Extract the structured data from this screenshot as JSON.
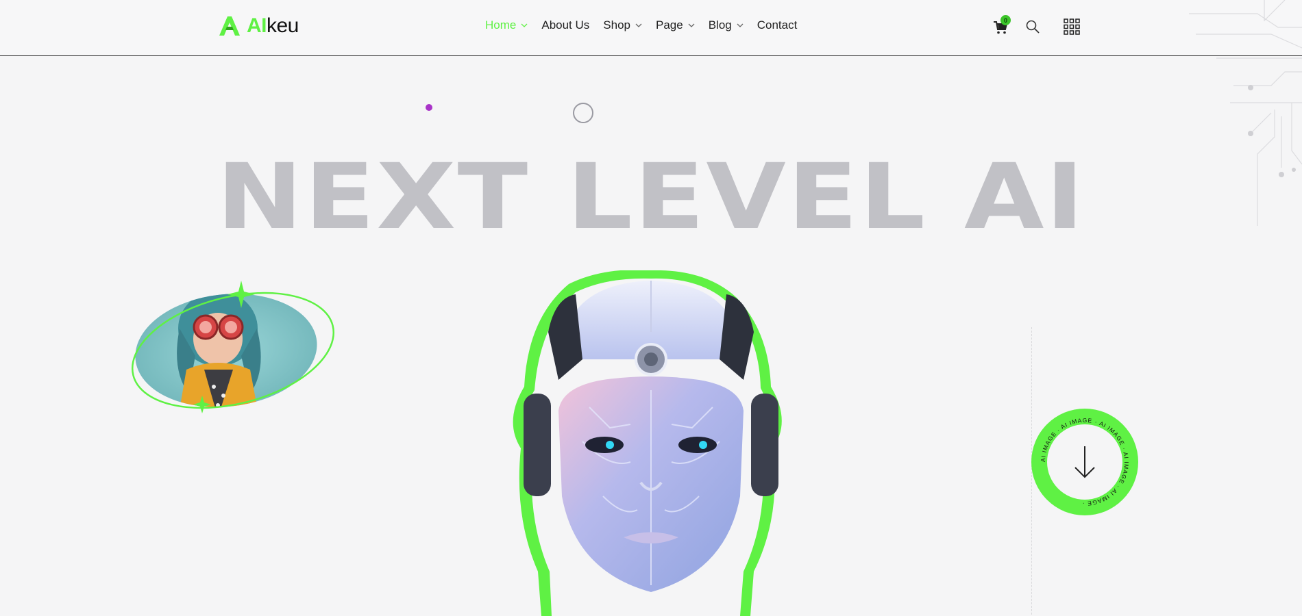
{
  "header": {
    "logo": {
      "ai": "AI",
      "rest": "keu"
    },
    "nav": [
      {
        "label": "Home",
        "dropdown": true,
        "active": true
      },
      {
        "label": "About Us",
        "dropdown": false,
        "active": false
      },
      {
        "label": "Shop",
        "dropdown": true,
        "active": false
      },
      {
        "label": "Page",
        "dropdown": true,
        "active": false
      },
      {
        "label": "Blog",
        "dropdown": true,
        "active": false
      },
      {
        "label": "Contact",
        "dropdown": false,
        "active": false
      }
    ],
    "cart_count": "0",
    "icons": [
      "cart-icon",
      "search-icon",
      "grid-menu-icon"
    ]
  },
  "hero": {
    "title": "NEXT LEVEL AI",
    "badge_text": "AI IMAGE · AI IMAGE · AI IMAGE · AI IMAGE · AI IMAGE ·",
    "scroll_icon": "arrow-down-icon"
  },
  "colors": {
    "accent_green": "#5ff144",
    "title_gray": "#c1c1c6",
    "dot_purple": "#a933c8",
    "background": "#f5f5f6"
  }
}
